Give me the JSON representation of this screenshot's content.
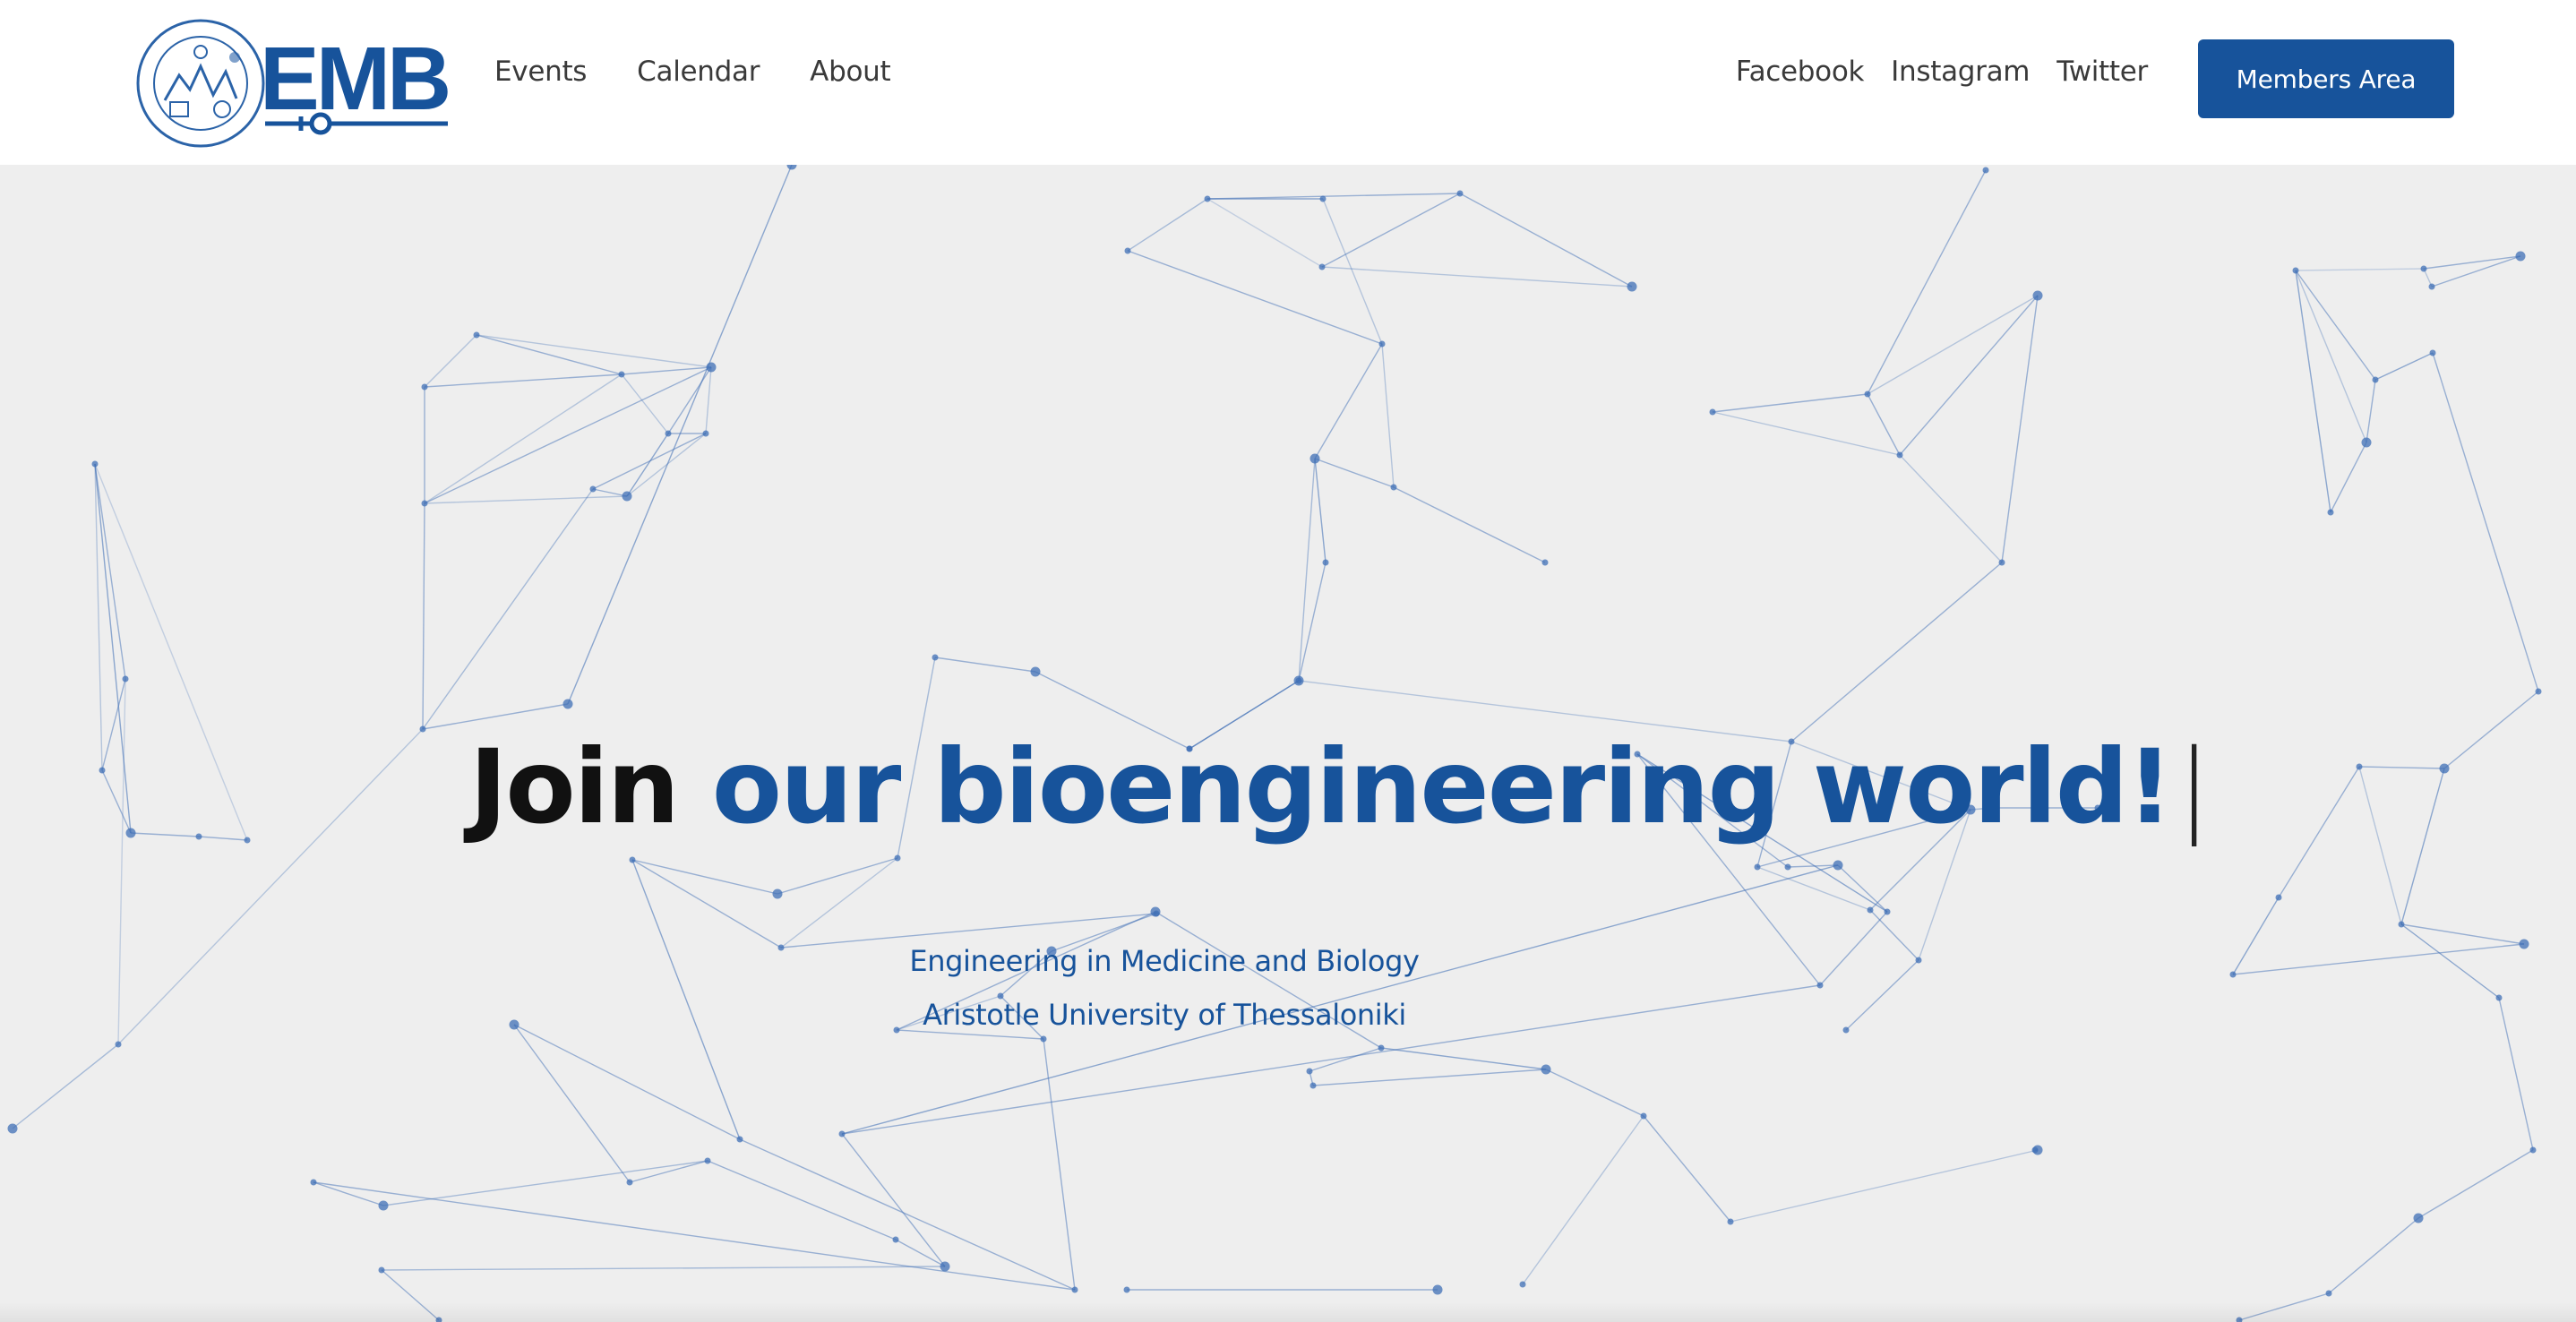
{
  "header": {
    "logo": {
      "text": "EMB",
      "ring_text": "Engineering in Medicine and Biology · Aristotle University of Thessaloniki"
    },
    "nav_left": [
      {
        "label": "Events"
      },
      {
        "label": "Calendar"
      },
      {
        "label": "About"
      }
    ],
    "nav_right": [
      {
        "label": "Facebook"
      },
      {
        "label": "Instagram"
      },
      {
        "label": "Twitter"
      }
    ],
    "members_button": "Members Area"
  },
  "hero": {
    "title_part1": "Join",
    "title_part2": "our bioengineering world!",
    "cursor": "|",
    "subtitle_line1": "Engineering in Medicine and Biology",
    "subtitle_line2": "Aristotle University of Thessaloniki"
  },
  "colors": {
    "brand_blue": "#17539b",
    "hero_bg": "#eeeeee",
    "network_line": "#3f6fb6"
  }
}
